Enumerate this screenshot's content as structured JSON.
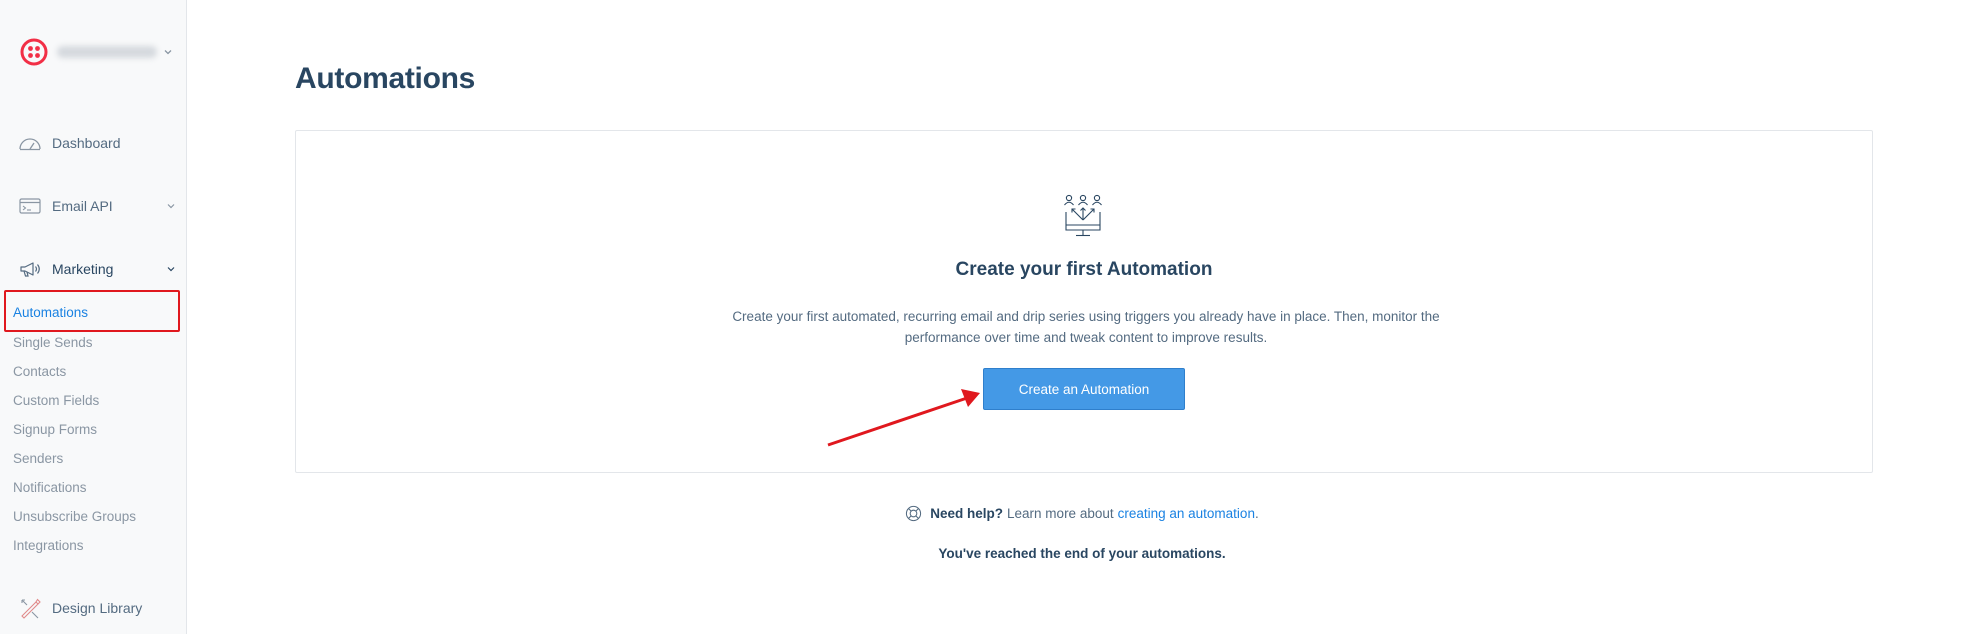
{
  "sidebar": {
    "account": {
      "name": ""
    },
    "nav": [
      {
        "label": "Dashboard",
        "icon": "speedometer-icon"
      },
      {
        "label": "Email API",
        "icon": "terminal-icon"
      },
      {
        "label": "Marketing",
        "icon": "megaphone-icon"
      }
    ],
    "marketing_items": [
      "Automations",
      "Single Sends",
      "Contacts",
      "Custom Fields",
      "Signup Forms",
      "Senders",
      "Notifications",
      "Unsubscribe Groups",
      "Integrations"
    ],
    "design_library": {
      "label": "Design Library",
      "icon": "design-tools-icon"
    }
  },
  "main": {
    "title": "Automations",
    "empty_state": {
      "heading": "Create your first Automation",
      "description": "Create your first automated, recurring email and drip series using triggers you already have in place. Then, monitor the performance over time and tweak content to improve results.",
      "button": "Create an Automation"
    },
    "help": {
      "bold": "Need help?",
      "text": "Learn more about",
      "link": "creating an automation",
      "suffix": "."
    },
    "end_message": "You've reached the end of your automations."
  },
  "colors": {
    "accent": "#1a82e2",
    "button": "#4499e6",
    "annotation_red": "#e0181e",
    "heading": "#294661"
  }
}
